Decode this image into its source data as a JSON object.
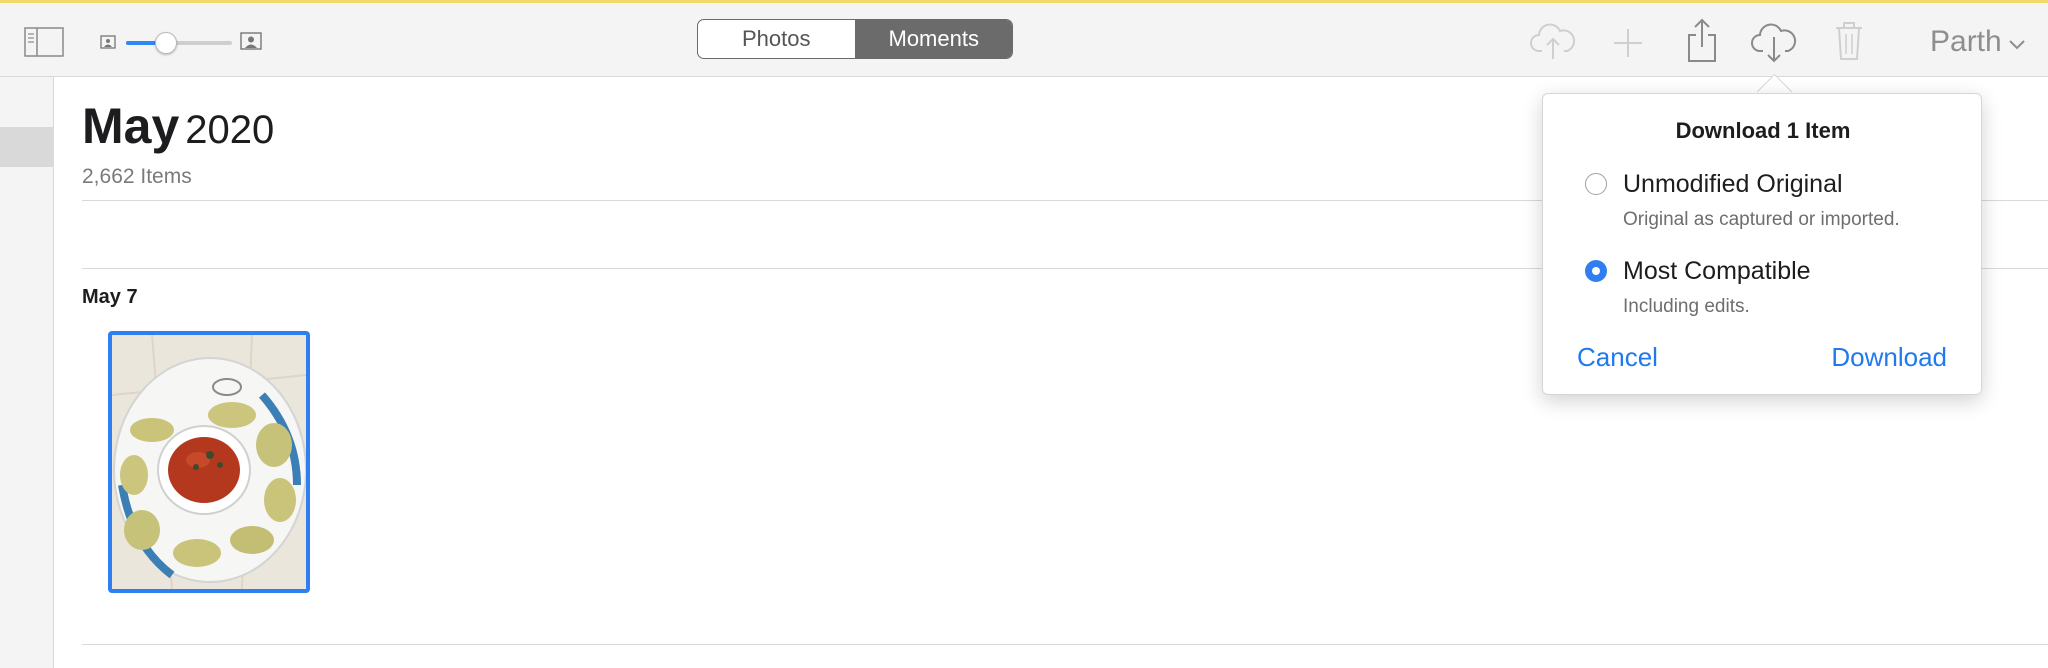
{
  "toolbar": {
    "icons": {
      "sidebar_toggle": "sidebar-icon",
      "zoom_small": "small-photo-icon",
      "zoom_large": "large-photo-icon",
      "upload": "cloud-upload-icon",
      "add": "plus-icon",
      "share": "share-icon",
      "download": "cloud-download-icon",
      "delete": "trash-icon"
    },
    "zoom_level": 0.38,
    "segments": {
      "photos": "Photos",
      "moments": "Moments",
      "selected": "Moments"
    },
    "user": "Parth"
  },
  "main": {
    "title_month": "May",
    "title_year": "2020",
    "item_count": "2,662 Items",
    "day_label": "May 7"
  },
  "popover": {
    "title": "Download 1 Item",
    "options": [
      {
        "label": "Unmodified Original",
        "description": "Original as captured or imported.",
        "selected": false
      },
      {
        "label": "Most Compatible",
        "description": "Including edits.",
        "selected": true
      }
    ],
    "cancel": "Cancel",
    "download": "Download"
  },
  "colors": {
    "accent": "#2f7ff0",
    "toolbar_bg": "#f4f4f4",
    "selected_segment": "#6b6b6b",
    "top_stripe": "#f2d96b"
  }
}
